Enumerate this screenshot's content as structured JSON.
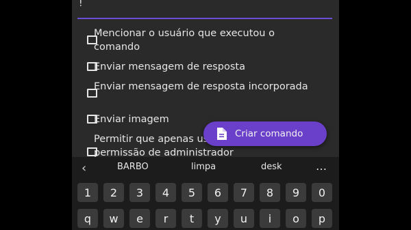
{
  "input": {
    "value": "!"
  },
  "options": [
    {
      "label": "Mencionar o usuário que executou o comando"
    },
    {
      "label": "Enviar mensagem de resposta"
    },
    {
      "label": "Enviar mensagem de resposta incorporada"
    },
    {
      "label": "Enviar imagem"
    },
    {
      "label": "Permitir que apenas usuários com permissão de administrador"
    }
  ],
  "fab": {
    "label": "Criar comando",
    "icon": "document-icon"
  },
  "colors": {
    "accent": "#6a3fc9",
    "underline": "#6b4fd8",
    "surface": "#2a2a2a",
    "keyboard": "#1c1c1c",
    "key": "#3b3b3b"
  },
  "keyboard": {
    "suggestions": [
      "BARBO",
      "limpa",
      "desk"
    ],
    "number_row": [
      "1",
      "2",
      "3",
      "4",
      "5",
      "6",
      "7",
      "8",
      "9",
      "0"
    ],
    "letter_row": [
      "q",
      "w",
      "e",
      "r",
      "t",
      "y",
      "u",
      "i",
      "o",
      "p"
    ]
  }
}
